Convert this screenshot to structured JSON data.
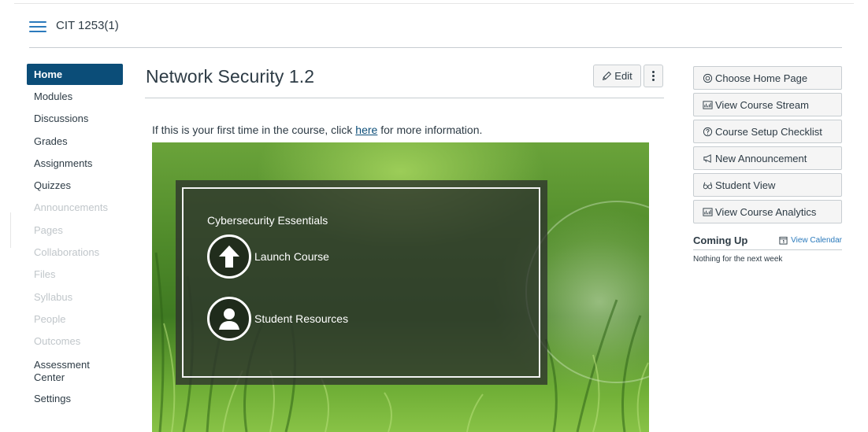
{
  "header": {
    "breadcrumb": "CIT 1253(1)"
  },
  "nav": {
    "items": [
      {
        "label": "Home",
        "state": "active"
      },
      {
        "label": "Modules",
        "state": "enabled"
      },
      {
        "label": "Discussions",
        "state": "enabled"
      },
      {
        "label": "Grades",
        "state": "enabled"
      },
      {
        "label": "Assignments",
        "state": "enabled"
      },
      {
        "label": "Quizzes",
        "state": "enabled"
      },
      {
        "label": "Announcements",
        "state": "disabled"
      },
      {
        "label": "Pages",
        "state": "disabled"
      },
      {
        "label": "Collaborations",
        "state": "disabled"
      },
      {
        "label": "Files",
        "state": "disabled"
      },
      {
        "label": "Syllabus",
        "state": "disabled"
      },
      {
        "label": "People",
        "state": "disabled"
      },
      {
        "label": "Outcomes",
        "state": "disabled"
      },
      {
        "label": "Assessment Center",
        "state": "enabled"
      },
      {
        "label": "Settings",
        "state": "enabled"
      }
    ]
  },
  "main": {
    "title": "Network Security 1.2",
    "edit_label": "Edit",
    "intro_before": "If this is your first time in the course, click ",
    "intro_link": "here",
    "intro_after": " for more information.",
    "banner": {
      "title": "Cybersecurity Essentials",
      "launch_label": "Launch Course",
      "resources_label": "Student Resources"
    }
  },
  "sidebar": {
    "buttons": [
      {
        "label": "Choose Home Page",
        "icon": "target-icon"
      },
      {
        "label": "View Course Stream",
        "icon": "stream-icon"
      },
      {
        "label": "Course Setup Checklist",
        "icon": "question-icon"
      },
      {
        "label": "New Announcement",
        "icon": "megaphone-icon"
      },
      {
        "label": "Student View",
        "icon": "glasses-icon"
      },
      {
        "label": "View Course Analytics",
        "icon": "analytics-icon"
      }
    ],
    "coming_up": {
      "title": "Coming Up",
      "calendar_link": "View Calendar",
      "empty_text": "Nothing for the next week"
    }
  },
  "colors": {
    "accent": "#0b4d78",
    "link": "#2b7abc",
    "text": "#2d3b45",
    "disabled": "#c0c6ca"
  }
}
